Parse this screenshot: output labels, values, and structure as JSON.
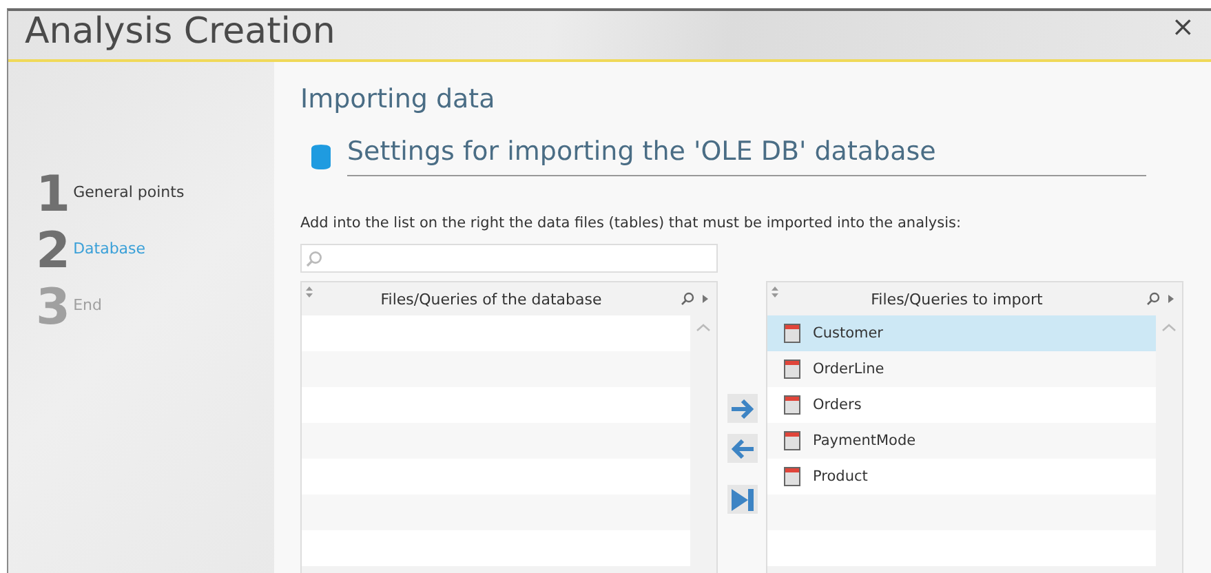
{
  "window": {
    "title": "Analysis Creation",
    "close_icon": "×"
  },
  "steps": [
    {
      "number": "1",
      "label": "General points",
      "selected": false,
      "disabled": false
    },
    {
      "number": "2",
      "label": "Database",
      "selected": true,
      "disabled": false
    },
    {
      "number": "3",
      "label": "End",
      "selected": false,
      "disabled": true
    }
  ],
  "page": {
    "title": "Importing data",
    "section_title": "Settings for importing the 'OLE DB' database",
    "instruction": "Add into the list on the right the data files (tables) that must be imported into the analysis:"
  },
  "source_grid": {
    "column": "Files/Queries of the database"
  },
  "target_grid": {
    "column": "Files/Queries to import",
    "rows": [
      {
        "name": "Customer",
        "selected": true
      },
      {
        "name": "OrderLine",
        "selected": false
      },
      {
        "name": "Orders",
        "selected": false
      },
      {
        "name": "PaymentMode",
        "selected": false
      },
      {
        "name": "Product",
        "selected": false
      }
    ]
  }
}
